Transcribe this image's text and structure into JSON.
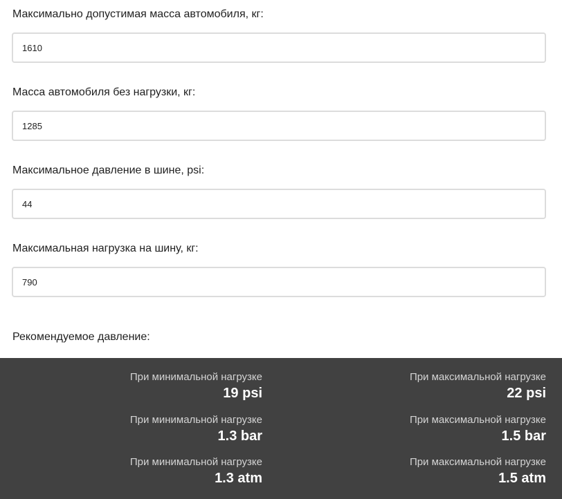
{
  "form": {
    "max_mass": {
      "label": "Максимально допустимая масса автомобиля, кг:",
      "value": "1610"
    },
    "empty_mass": {
      "label": "Масса автомобиля без нагрузки, кг:",
      "value": "1285"
    },
    "max_pressure": {
      "label": "Максимальное давление в шине, psi:",
      "value": "44"
    },
    "max_tire_load": {
      "label": "Максимальная нагрузка на шину, кг:",
      "value": "790"
    }
  },
  "results": {
    "title": "Рекомендуемое давление:",
    "rows": [
      {
        "min_caption": "При минимальной нагрузке",
        "min_value": "19 psi",
        "max_caption": "При максимальной нагрузке",
        "max_value": "22 psi"
      },
      {
        "min_caption": "При минимальной нагрузке",
        "min_value": "1.3 bar",
        "max_caption": "При максимальной нагрузке",
        "max_value": "1.5 bar"
      },
      {
        "min_caption": "При минимальной нагрузке",
        "min_value": "1.3 atm",
        "max_caption": "При максимальной нагрузке",
        "max_value": "1.5 atm"
      }
    ]
  }
}
